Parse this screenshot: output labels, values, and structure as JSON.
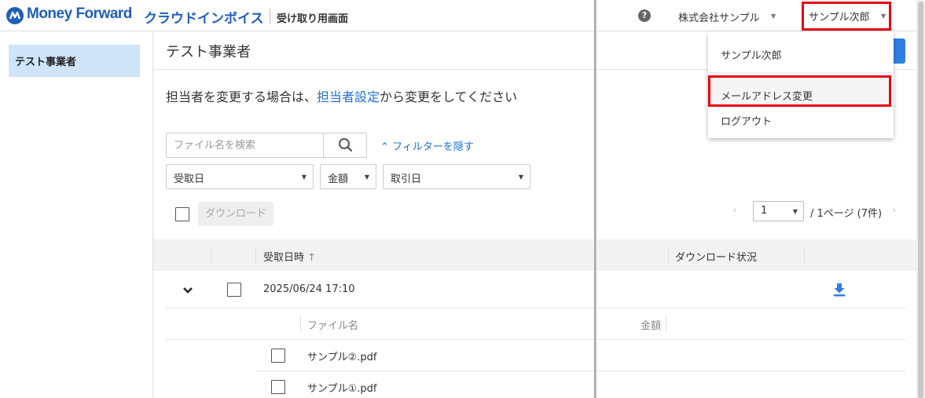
{
  "header": {
    "brand": "Money Forward",
    "product": "クラウドインボイス",
    "subtitle": "受け取り用画面",
    "help": "?",
    "company": "株式会社サンプル",
    "user": "サンプル次郎"
  },
  "sidebar": {
    "items": [
      {
        "label": "テスト事業者"
      }
    ]
  },
  "main": {
    "title": "テスト事業者",
    "info_prefix": "担当者を変更する場合は、",
    "info_link": "担当者設定",
    "info_suffix": "から変更をしてください",
    "search_placeholder": "ファイル名を検索",
    "filter_toggle": "フィルターを隠す",
    "filters": [
      "受取日",
      "金額",
      "取引日"
    ],
    "download_label": "ダウンロード",
    "pagination": {
      "page": "1",
      "info": "/  1ページ (7件)"
    },
    "table": {
      "col_received": "受取日時",
      "col_status": "ダウンロード状況",
      "row_date": "2025/06/24 17:10",
      "sub_col_file": "ファイル名",
      "sub_col_amount": "金額",
      "files": [
        "サンプル②.pdf",
        "サンプル①.pdf"
      ]
    }
  },
  "menu": {
    "user": "サンプル次郎",
    "email_change": "メールアドレス変更",
    "logout": "ログアウト"
  },
  "colors": {
    "brand": "#1f5fb8",
    "link": "#1f6fd1",
    "highlight": "#e60012",
    "selected": "#cfe4f9"
  }
}
